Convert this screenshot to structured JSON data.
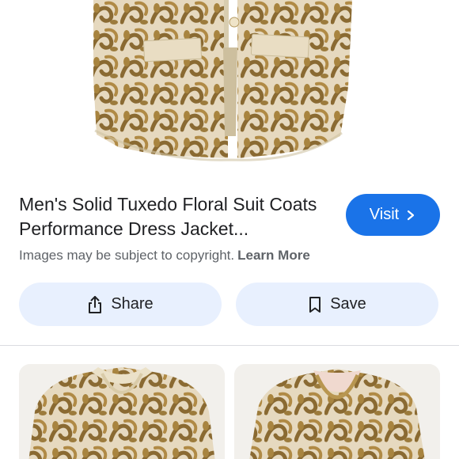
{
  "result": {
    "title": "Men's Solid Tuxedo Floral Suit Coats Performance Dress Jacket...",
    "visit_label": "Visit"
  },
  "copyright": {
    "text": "Images may be subject to copyright.",
    "learn_more": "Learn More"
  },
  "actions": {
    "share_label": "Share",
    "save_label": "Save"
  },
  "related": [
    {
      "icon": "gold-sequin-jacket-image"
    },
    {
      "icon": "gold-sequin-jacket-image"
    }
  ],
  "colors": {
    "accent": "#1a73e8",
    "pill_background": "#e8f0fe",
    "muted_text": "#5f6368",
    "jacket_gold": "#c9a86a",
    "jacket_cream": "#e8dcc2"
  }
}
